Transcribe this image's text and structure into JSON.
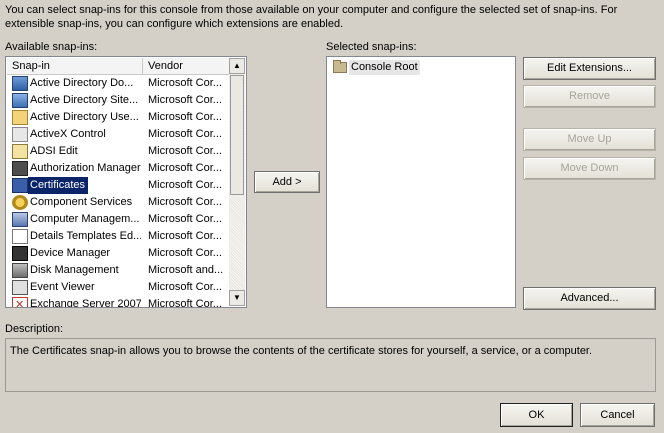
{
  "intro_text": "You can select snap-ins for this console from those available on your computer and configure the selected set of snap-ins. For extensible snap-ins, you can configure which extensions are enabled.",
  "available": {
    "label": "Available snap-ins:",
    "columns": {
      "snapin": "Snap-in",
      "vendor": "Vendor"
    },
    "rows": [
      {
        "name": "Active Directory Do...",
        "vendor": "Microsoft Cor...",
        "icon": "active-directory-domains-icon"
      },
      {
        "name": "Active Directory Site...",
        "vendor": "Microsoft Cor...",
        "icon": "active-directory-sites-icon"
      },
      {
        "name": "Active Directory Use...",
        "vendor": "Microsoft Cor...",
        "icon": "active-directory-users-icon"
      },
      {
        "name": "ActiveX Control",
        "vendor": "Microsoft Cor...",
        "icon": "activex-control-icon"
      },
      {
        "name": "ADSI Edit",
        "vendor": "Microsoft Cor...",
        "icon": "adsi-edit-icon"
      },
      {
        "name": "Authorization Manager",
        "vendor": "Microsoft Cor...",
        "icon": "authorization-manager-icon"
      },
      {
        "name": "Certificates",
        "vendor": "Microsoft Cor...",
        "icon": "certificates-icon",
        "selected": true
      },
      {
        "name": "Component Services",
        "vendor": "Microsoft Cor...",
        "icon": "component-services-icon"
      },
      {
        "name": "Computer Managem...",
        "vendor": "Microsoft Cor...",
        "icon": "computer-management-icon"
      },
      {
        "name": "Details Templates Ed...",
        "vendor": "Microsoft Cor...",
        "icon": "details-templates-icon"
      },
      {
        "name": "Device Manager",
        "vendor": "Microsoft Cor...",
        "icon": "device-manager-icon"
      },
      {
        "name": "Disk Management",
        "vendor": "Microsoft and...",
        "icon": "disk-management-icon"
      },
      {
        "name": "Event Viewer",
        "vendor": "Microsoft Cor...",
        "icon": "event-viewer-icon"
      },
      {
        "name": "Exchange Server 2007",
        "vendor": "Microsoft Cor...",
        "icon": "exchange-server-icon"
      }
    ]
  },
  "add_button": "Add >",
  "selected": {
    "label": "Selected snap-ins:",
    "items": [
      {
        "name": "Console Root",
        "icon": "folder-icon"
      }
    ]
  },
  "buttons": {
    "edit_extensions": "Edit Extensions...",
    "remove": "Remove",
    "move_up": "Move Up",
    "move_down": "Move Down",
    "advanced": "Advanced...",
    "ok": "OK",
    "cancel": "Cancel"
  },
  "description": {
    "label": "Description:",
    "text": "The Certificates snap-in allows you to browse the contents of the certificate stores for yourself, a service, or a computer."
  },
  "colors": {
    "selection": "#0a246a",
    "dialog_bg": "#d4d0c8"
  }
}
